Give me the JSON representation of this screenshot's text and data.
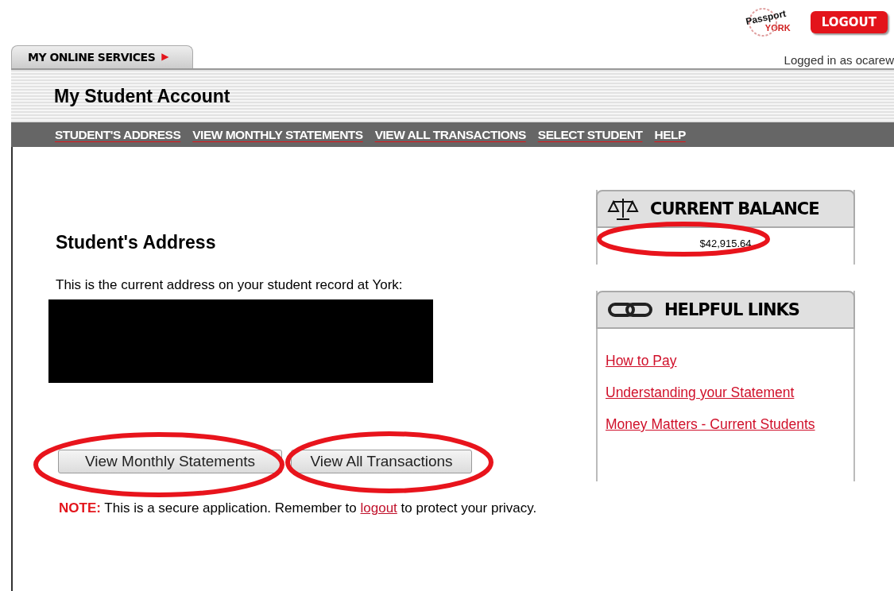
{
  "header": {
    "logo": {
      "top": "Passport",
      "bottom": "YORK"
    },
    "logout_button": "LOGOUT",
    "tab": {
      "label": "MY ONLINE SERVICES",
      "arrow": "▶"
    },
    "logged_in": "Logged in as ocarew"
  },
  "page_title": "My Student Account",
  "nav": [
    {
      "label": "STUDENT'S ADDRESS"
    },
    {
      "label": "VIEW MONTHLY STATEMENTS"
    },
    {
      "label": "VIEW ALL TRANSACTIONS"
    },
    {
      "label": "SELECT STUDENT"
    },
    {
      "label": "HELP"
    }
  ],
  "main": {
    "heading": "Student's Address",
    "intro": "This is the current address on your student record at York:",
    "buttons": [
      "View Monthly Statements",
      "View All Transactions"
    ],
    "note": {
      "label": "NOTE:",
      "before": "This is a secure application. Remember to",
      "link": "logout",
      "after": "to protect your privacy."
    }
  },
  "balance_panel": {
    "title": "CURRENT BALANCE",
    "amount": "$42,915.64"
  },
  "links_panel": {
    "title": "HELPFUL LINKS",
    "links": [
      "How to Pay",
      "Understanding your Statement",
      "Money Matters - Current Students"
    ]
  }
}
